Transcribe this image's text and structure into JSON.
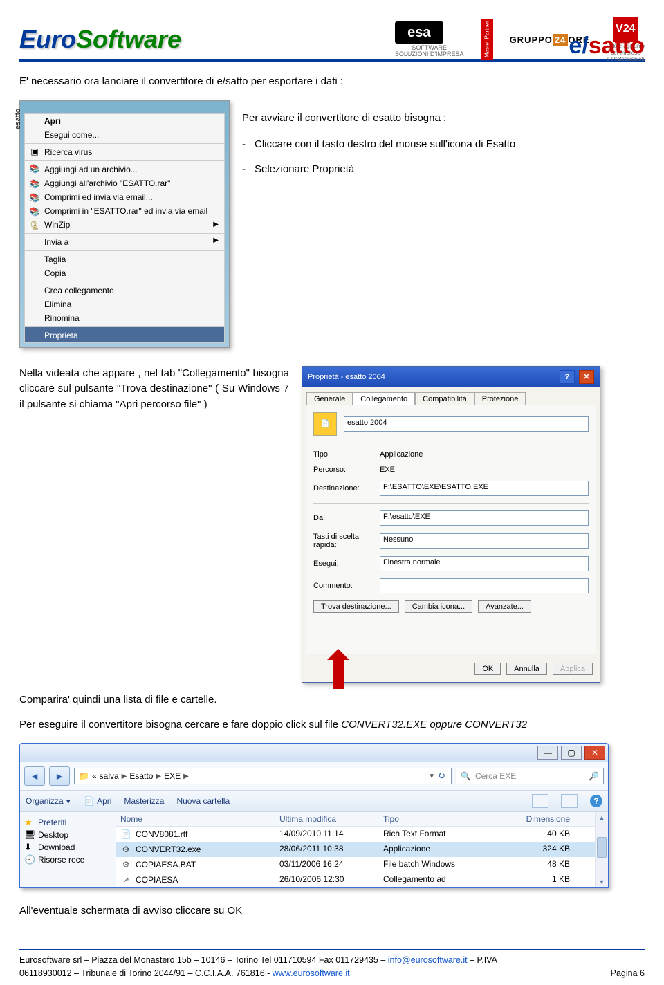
{
  "header": {
    "euro": "Euro",
    "soft": "Software",
    "esa": {
      "brand": "esa",
      "line1": "SOFTWARE",
      "line2": "SOLUZIONI D'IMPRESA"
    },
    "mp": "Master Partner",
    "gruppo": {
      "pre": "GRUPPO",
      "mid": "24",
      "post": "ORE"
    },
    "v24": {
      "badge": "V24",
      "line1": "Valore aggiunto",
      "line2": "per Imprese",
      "line3": "e Professionisti"
    },
    "brand_e": "e",
    "brand_slash": "/",
    "brand_satto": "satto"
  },
  "intro": "E' necessario ora lanciare il convertitore di e/satto per esportare i dati :",
  "start_line": "Per avviare il convertitore di esatto bisogna :",
  "bullets": [
    "Cliccare con il tasto destro del mouse sull'icona di Esatto",
    "Selezionare Proprietà"
  ],
  "ctxmenu": {
    "apri": "Apri",
    "esegui": "Esegui come...",
    "ricerca": "Ricerca virus",
    "agg1": "Aggiungi ad un archivio...",
    "agg2": "Aggiungi all'archivio \"ESATTO.rar\"",
    "comp1": "Comprimi ed invia via email...",
    "comp2": "Comprimi in \"ESATTO.rar\" ed invia via email",
    "winzip": "WinZip",
    "invia": "Invia a",
    "taglia": "Taglia",
    "copia": "Copia",
    "crea": "Crea collegamento",
    "elimina": "Elimina",
    "rinomina": "Rinomina",
    "proprieta": "Proprietà"
  },
  "text_collegamento": "Nella videata che appare , nel tab \"Collegamento\" bisogna cliccare sul pulsante \"Trova destinazione\" ( Su Windows 7 il pulsante si chiama  \"Apri percorso file\" )",
  "props": {
    "title": "Proprietà - esatto 2004",
    "tabs": [
      "Generale",
      "Collegamento",
      "Compatibilità",
      "Protezione"
    ],
    "name": "esatto 2004",
    "labels": {
      "tipo": "Tipo:",
      "percorso": "Percorso:",
      "dest": "Destinazione:",
      "da": "Da:",
      "tasti": "Tasti di scelta rapida:",
      "esegui": "Esegui:",
      "commento": "Commento:"
    },
    "values": {
      "tipo": "Applicazione",
      "percorso": "EXE",
      "dest": "F:\\ESATTO\\EXE\\ESATTO.EXE",
      "da": "F:\\esatto\\EXE",
      "tasti": "Nessuno",
      "esegui": "Finestra normale",
      "commento": ""
    },
    "buttons": {
      "trova": "Trova destinazione...",
      "cambia": "Cambia icona...",
      "avanzate": "Avanzate...",
      "ok": "OK",
      "annulla": "Annulla",
      "applica": "Applica"
    }
  },
  "text_lista": "Comparira' quindi una lista di file e cartelle.",
  "text_convert_pre": "Per eseguire il convertitore bisogna cercare e fare doppio click sul file ",
  "text_convert_file": "CONVERT32.EXE oppure CONVERT32",
  "explorer": {
    "breadcrumb": [
      "salva",
      "Esatto",
      "EXE"
    ],
    "search_placeholder": "Cerca EXE",
    "toolbar": {
      "organizza": "Organizza",
      "apri": "Apri",
      "masterizza": "Masterizza",
      "nuova": "Nuova cartella"
    },
    "side": [
      {
        "label": "Preferiti",
        "icon": "★",
        "class": "fav"
      },
      {
        "label": "Desktop",
        "icon": "🖥"
      },
      {
        "label": "Download",
        "icon": "⬇"
      },
      {
        "label": "Risorse rece",
        "icon": "🕘"
      }
    ],
    "columns": {
      "name": "Nome",
      "date": "Ultima modifica",
      "type": "Tipo",
      "size": "Dimensione"
    },
    "rows": [
      {
        "name": "CONV8081.rtf",
        "date": "14/09/2010 11:14",
        "type": "Rich Text Format",
        "size": "40 KB",
        "icon": "rtf"
      },
      {
        "name": "CONVERT32.exe",
        "date": "28/06/2011 10:38",
        "type": "Applicazione",
        "size": "324 KB",
        "icon": "exe",
        "selected": true
      },
      {
        "name": "COPIAESA.BAT",
        "date": "03/11/2006 16:24",
        "type": "File batch Windows",
        "size": "48 KB",
        "icon": "bat"
      },
      {
        "name": "COPIAESA",
        "date": "26/10/2006 12:30",
        "type": "Collegamento ad",
        "size": "1 KB",
        "icon": "lnk"
      }
    ]
  },
  "text_ok": "All'eventuale schermata di avviso cliccare su OK",
  "footer": {
    "line1a": "Eurosoftware srl – Piazza del Monastero 15b – 10146 – Torino  Tel 011710594  Fax 011729435 – ",
    "email": "info@eurosoftware.it",
    "line1b": " – P.IVA",
    "line2a": "06118930012 – Tribunale di Torino 2044/91 – C.C.I.A.A. 761816 - ",
    "web": "www.eurosoftware.it",
    "page": "Pagina 6"
  }
}
